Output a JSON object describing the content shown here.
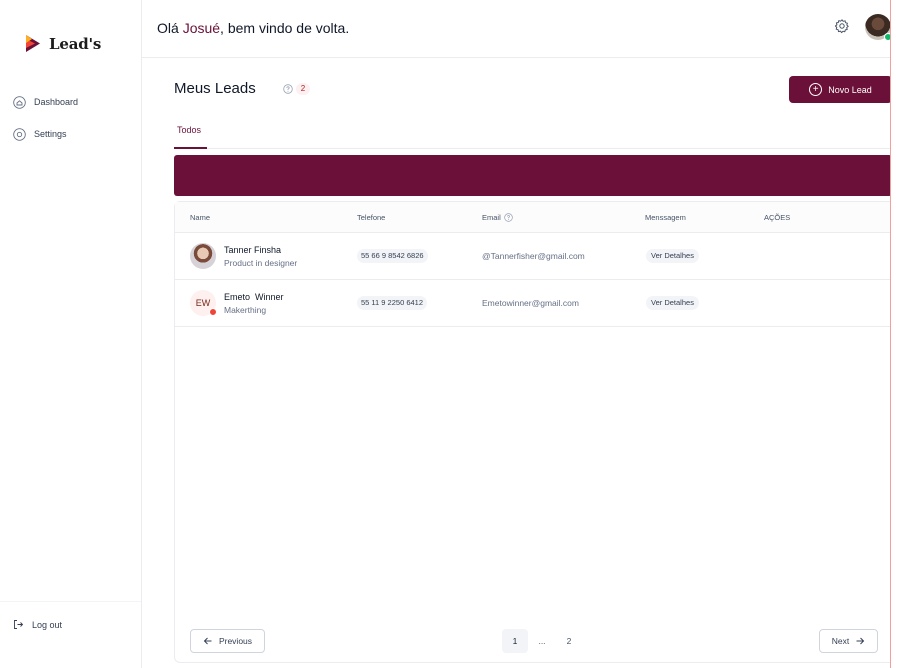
{
  "brand": {
    "name": "Lead's"
  },
  "sidebar": {
    "items": [
      {
        "label": "Dashboard",
        "icon": "home-icon"
      },
      {
        "label": "Settings",
        "icon": "settings-icon"
      }
    ],
    "logout": {
      "label": "Log out",
      "icon": "logout-icon"
    }
  },
  "header": {
    "greeting_prefix": "Olá ",
    "user_name": "Josué",
    "greeting_suffix": ", bem vindo de volta.",
    "online_status_color": "#12b76a"
  },
  "main": {
    "title": "Meus Leads",
    "count": "2",
    "new_lead_label": "Novo Lead",
    "tabs": [
      {
        "label": "Todos"
      }
    ],
    "accent_color": "#6b1038"
  },
  "table": {
    "headers": {
      "name": "Name",
      "phone": "Telefone",
      "email": "Email",
      "message": "Menssagem",
      "actions": "AÇÕES"
    },
    "rows": [
      {
        "name": "Tanner Finsha",
        "role": "Product in designer",
        "phone": "55 66 9 8542 6826",
        "email": "@Tannerfisher@gmail.com",
        "details": "Ver Detalhes",
        "avatar": "photo"
      },
      {
        "name": "Emeto  Winner",
        "role": "Makerthing",
        "initials": "EW",
        "phone": "55 11 9 2250 6412",
        "email": "Emetowinner@gmail.com",
        "details": "Ver Detalhes",
        "avatar": "initials",
        "status_color": "#f04438"
      }
    ]
  },
  "pagination": {
    "previous": "Previous",
    "next": "Next",
    "pages": [
      "1",
      "...",
      "2"
    ],
    "current": "1"
  }
}
